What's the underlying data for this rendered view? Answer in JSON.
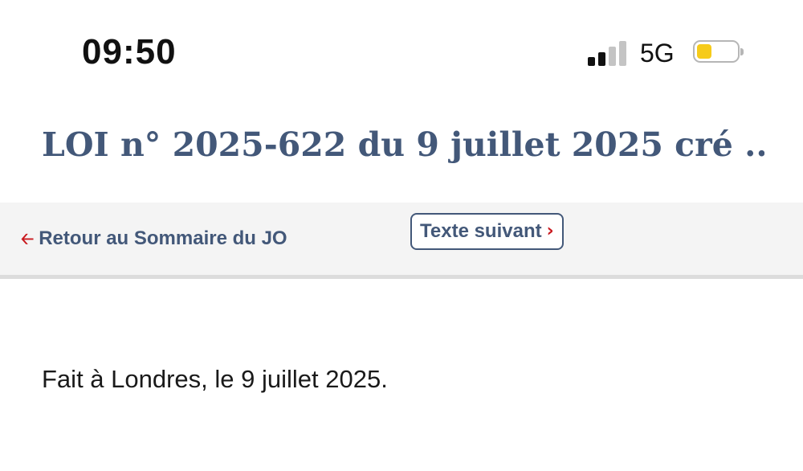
{
  "status_bar": {
    "time": "09:50",
    "network": "5G",
    "signal_bars_active": 2,
    "signal_bars_total": 4,
    "battery_level_fraction": 0.3,
    "colors": {
      "signal_active": "#111111",
      "signal_inactive": "#c4c4c4",
      "battery_fill": "#f6cb1a"
    }
  },
  "header": {
    "title": "LOI n° 2025-622 du 9 juillet 2025 cré ..."
  },
  "nav": {
    "back_icon": "left-arrow-icon",
    "back_label": "Retour au Sommaire du JO",
    "next_label": "Texte suivant",
    "next_icon": "chevron-right-icon"
  },
  "content": {
    "text": "Fait à Londres, le 9 juillet 2025."
  },
  "colors": {
    "title": "#435879",
    "accent_red": "#c9191e",
    "nav_background": "#f4f4f4",
    "nav_border": "#dcdcdc"
  }
}
